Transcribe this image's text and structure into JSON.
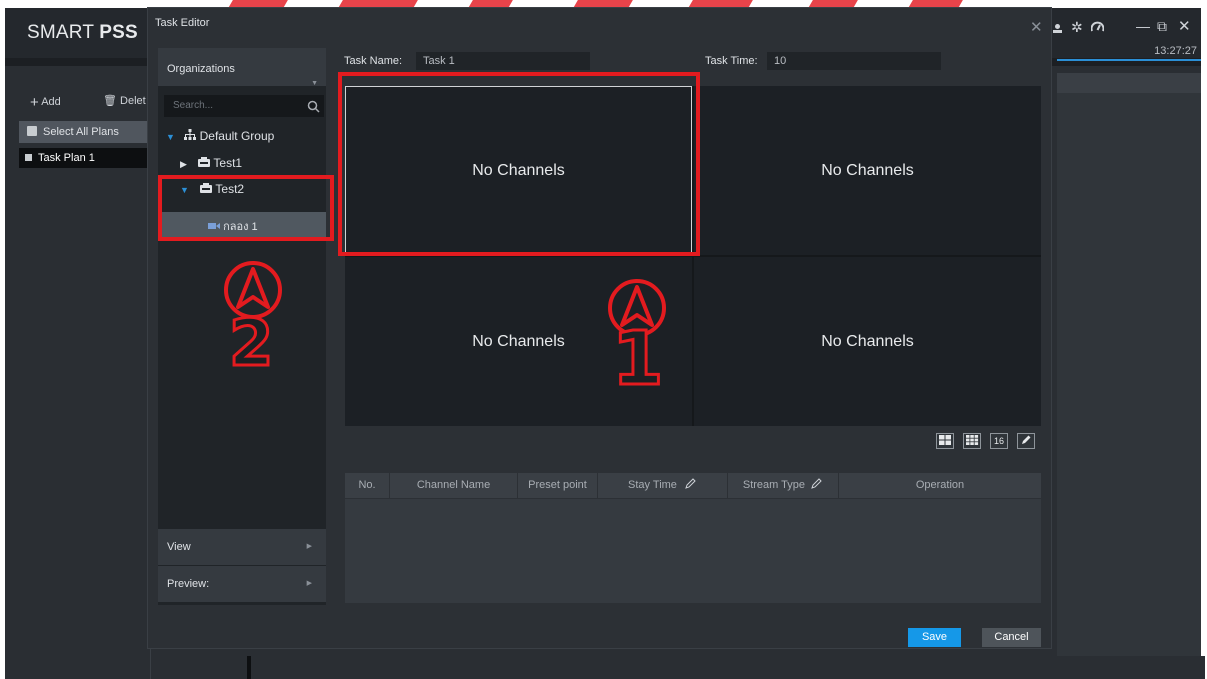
{
  "app": {
    "logo_light": "SMART ",
    "logo_bold": "PSS",
    "clock": "13:27:27",
    "toolbar": {
      "add_label": "Add",
      "delete_label": "Delet"
    },
    "plans": {
      "select_all": "Select All Plans",
      "items": [
        "Task Plan 1"
      ]
    }
  },
  "dialog": {
    "title": "Task Editor",
    "organizations_label": "Organizations",
    "search_placeholder": "Search...",
    "tree": {
      "root": "Default Group",
      "devices": [
        {
          "label": "Test1",
          "expanded": false
        },
        {
          "label": "Test2",
          "expanded": true,
          "channels": [
            "กลอง 1"
          ]
        }
      ]
    },
    "view_label": "View",
    "preview_label": "Preview:",
    "task_name_label": "Task Name:",
    "task_name_value": "Task 1",
    "task_time_label": "Task Time:",
    "task_time_value": "10",
    "cells": [
      "No Channels",
      "No Channels",
      "No Channels",
      "No Channels"
    ],
    "layout_icon_16": "16",
    "table_headers": [
      "No.",
      "Channel Name",
      "Preset point",
      "Stay Time",
      "Stream Type",
      "Operation"
    ],
    "save_label": "Save",
    "cancel_label": "Cancel"
  },
  "annotations": {
    "box1_number": "1",
    "box2_number": "2"
  },
  "colors": {
    "accent": "#1598e8",
    "annotation": "#e31b1f",
    "background": "#1c1f23"
  }
}
